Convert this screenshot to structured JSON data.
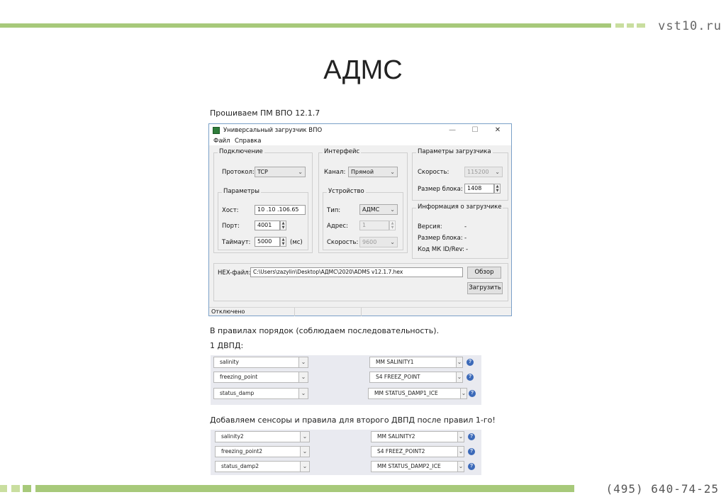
{
  "slide": {
    "site": "vst10.ru",
    "title": "АДМС",
    "phone": "(495) 640-74-25",
    "caption1": "Прошиваем ПМ ВПО 12.1.7",
    "caption2": "В правилах порядок (соблюдаем последовательность).",
    "caption3": "1 ДВПД:",
    "caption4": "Добавляем сенсоры и правила для второго ДВПД после правил 1-го!",
    "accent_color": "#a7c97a"
  },
  "window": {
    "title": "Универсальный загрузчик ВПО",
    "controls": {
      "minimize": "—",
      "maximize": "☐",
      "close": "✕"
    },
    "menu": [
      "Файл",
      "Справка"
    ],
    "connection": {
      "title": "Подключение",
      "protocol_label": "Протокол:",
      "protocol_value": "TCP"
    },
    "params": {
      "title": "Параметры",
      "host_label": "Хост:",
      "host_value": "10 .10 .106.65",
      "port_label": "Порт:",
      "port_value": "4001",
      "timeout_label": "Таймаут:",
      "timeout_value": "5000",
      "timeout_unit": "(мс)"
    },
    "interface": {
      "title": "Интерфейс",
      "channel_label": "Канал:",
      "channel_value": "Прямой"
    },
    "device": {
      "title": "Устройство",
      "type_label": "Тип:",
      "type_value": "АДМС",
      "address_label": "Адрес:",
      "address_value": "1",
      "speed_label": "Скорость:",
      "speed_value": "9600"
    },
    "load_params": {
      "title": "Параметры загрузчика",
      "speed_label": "Скорость:",
      "speed_value": "115200",
      "block_label": "Размер блока:",
      "block_value": "1408"
    },
    "loader_info": {
      "title": "Информация о загрузчике",
      "version_label": "Версия:",
      "version_value": "-",
      "block_label": "Размер блока:",
      "block_value": "-",
      "mk_label": "Код МК ID/Rev:",
      "mk_value": "-"
    },
    "hex": {
      "label": "HEX-файл:",
      "path": "C:\\Users\\zazylin\\Desktop\\АДМС\\2020\\ADMS v12.1.7.hex",
      "browse_label": "Обзор",
      "load_label": "Загрузить"
    },
    "status": "Отключено"
  },
  "rules1": [
    {
      "sensor": "salinity",
      "rule": "MM SALINITY1"
    },
    {
      "sensor": "freezing_point",
      "rule": "S4 FREEZ_POINT"
    },
    {
      "sensor": "status_damp",
      "rule": "MM STATUS_DAMP1_ICE"
    }
  ],
  "rules2": [
    {
      "sensor": "salinity2",
      "rule": "MM SALINITY2"
    },
    {
      "sensor": "freezing_point2",
      "rule": "S4 FREEZ_POINT2"
    },
    {
      "sensor": "status_damp2",
      "rule": "MM STATUS_DAMP2_ICE"
    }
  ],
  "icons": {
    "dropdown": "chevron-down-icon",
    "help": "help-icon",
    "help_glyph": "?"
  }
}
